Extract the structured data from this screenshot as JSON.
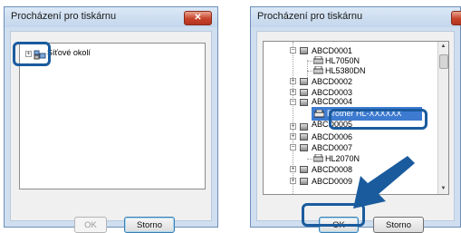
{
  "left_dialog": {
    "title": "Procházení pro tiskárnu",
    "close_glyph": "✕",
    "tree": {
      "root_label": "Síťové okolí",
      "expander": "+"
    },
    "ok_label": "OK",
    "cancel_label": "Storno"
  },
  "right_dialog": {
    "title": "Procházení pro tiskárnu",
    "tree": {
      "nodes": [
        {
          "label": "ABCD0001",
          "type": "server",
          "expander": "−"
        },
        {
          "label": "HL7050N",
          "type": "printer"
        },
        {
          "label": "HL5380DN",
          "type": "printer"
        },
        {
          "label": "ABCD0002",
          "type": "server",
          "expander": "+"
        },
        {
          "label": "ABCD0003",
          "type": "server",
          "expander": "+"
        },
        {
          "label": "ABCD0004",
          "type": "server",
          "expander": "−"
        },
        {
          "label": "Brother HL-XXXXXX",
          "type": "printer",
          "selected": true
        },
        {
          "label": "ABCD0005",
          "type": "server",
          "expander": "+"
        },
        {
          "label": "ABCD0006",
          "type": "server",
          "expander": "+"
        },
        {
          "label": "ABCD0007",
          "type": "server",
          "expander": "−"
        },
        {
          "label": "HL2070N",
          "type": "printer"
        },
        {
          "label": "ABCD0008",
          "type": "server",
          "expander": "+"
        },
        {
          "label": "ABCD0009",
          "type": "server",
          "expander": "+"
        }
      ]
    },
    "scroll_up": "▲",
    "scroll_down": "▼",
    "ok_label": "OK",
    "cancel_label": "Storno"
  },
  "colors": {
    "highlight": "#1a5b9e",
    "selection": "#3d7bd1",
    "frame": "#cfdff0"
  }
}
